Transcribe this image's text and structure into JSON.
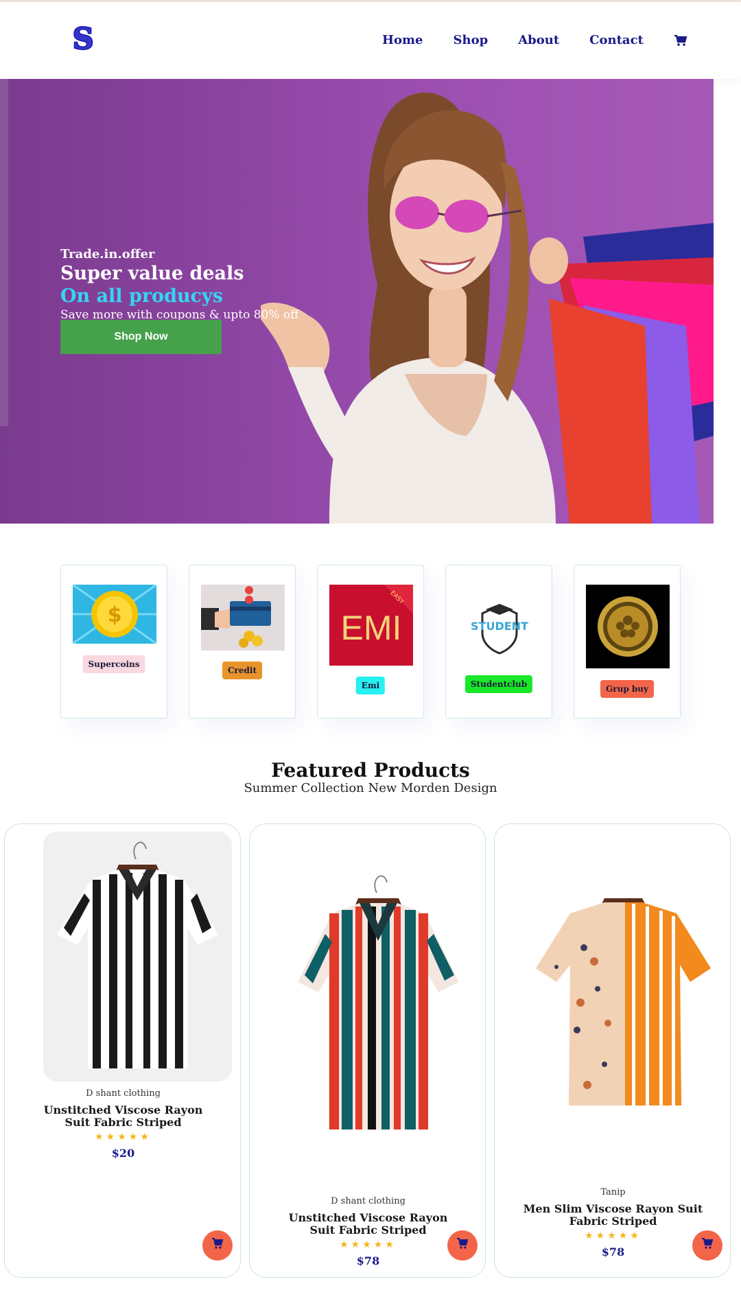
{
  "header": {
    "logo_letter": "S",
    "nav": [
      "Home",
      "Shop",
      "About",
      "Contact"
    ]
  },
  "hero": {
    "tagline": "Trade.in.offer",
    "title": "Super value deals",
    "subtitle": "On all producys",
    "description": "Save more with coupons & upto 80% off",
    "button": "Shop Now"
  },
  "offers": [
    {
      "label": "Supercoins",
      "badge_color": "#f9d8e0",
      "icon": "supercoin-icon"
    },
    {
      "label": "Credit",
      "badge_color": "#e8942c",
      "icon": "credit-card-icon"
    },
    {
      "label": "Emi",
      "badge_color": "#26f0f0",
      "icon": "emi-icon"
    },
    {
      "label": "Studentclub",
      "badge_color": "#19e82a",
      "icon": "student-club-icon"
    },
    {
      "label": "Grup buy",
      "badge_color": "#f26549",
      "icon": "group-buy-icon"
    }
  ],
  "featured": {
    "title": "Featured Products",
    "subtitle": "Summer Collection New Morden Design"
  },
  "products": [
    {
      "brand": "D shant clothing",
      "name": "Unstitched Viscose Rayon Suit Fabric Striped",
      "rating": 5,
      "price": "$20"
    },
    {
      "brand": "D shant clothing",
      "name": "Unstitched Viscose Rayon Suit Fabric Striped",
      "rating": 5,
      "price": "$78"
    },
    {
      "brand": "Tanip",
      "name": "Men Slim Viscose Rayon Suit Fabric Striped",
      "rating": 5,
      "price": "$78"
    }
  ],
  "colors": {
    "nav_text": "#1a1a8c",
    "hero_highlight": "#34d6f5",
    "shop_button": "#46a14b",
    "cart_button": "#f26549",
    "star": "#f3b519"
  }
}
